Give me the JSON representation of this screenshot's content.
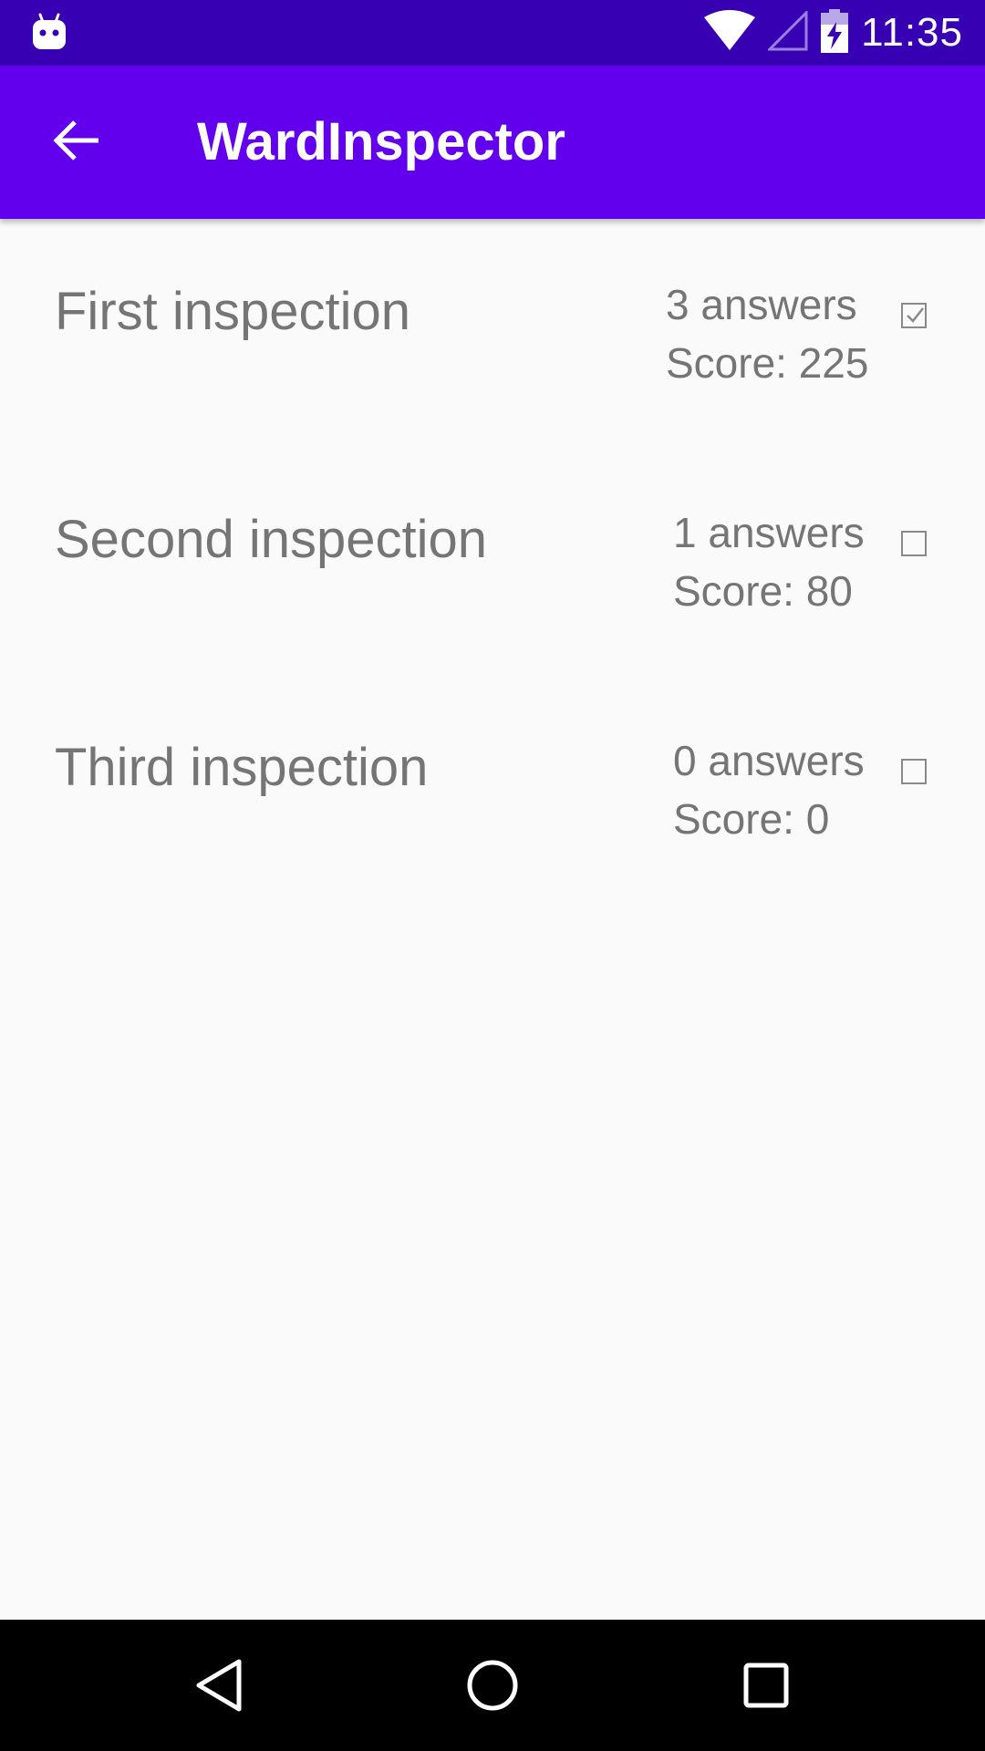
{
  "status_bar": {
    "time": "11:35",
    "icons": [
      "android-debug-icon",
      "wifi-icon",
      "signal-icon",
      "battery-charging-icon"
    ]
  },
  "app_bar": {
    "title": "WardInspector",
    "back_icon": "back-arrow-icon"
  },
  "inspections": [
    {
      "title": "First inspection",
      "answers": "3 answers",
      "score": "Score: 225",
      "checked": true
    },
    {
      "title": "Second inspection",
      "answers": "1 answers",
      "score": "Score: 80",
      "checked": false
    },
    {
      "title": "Third inspection",
      "answers": "0 answers",
      "score": "Score: 0",
      "checked": false
    }
  ],
  "nav_bar": {
    "icons": [
      "back-triangle-icon",
      "home-circle-icon",
      "recents-square-icon"
    ]
  },
  "colors": {
    "status_bar": "#3700b3",
    "app_bar": "#6200ee",
    "background": "#fafafa",
    "text_secondary": "#757575"
  }
}
